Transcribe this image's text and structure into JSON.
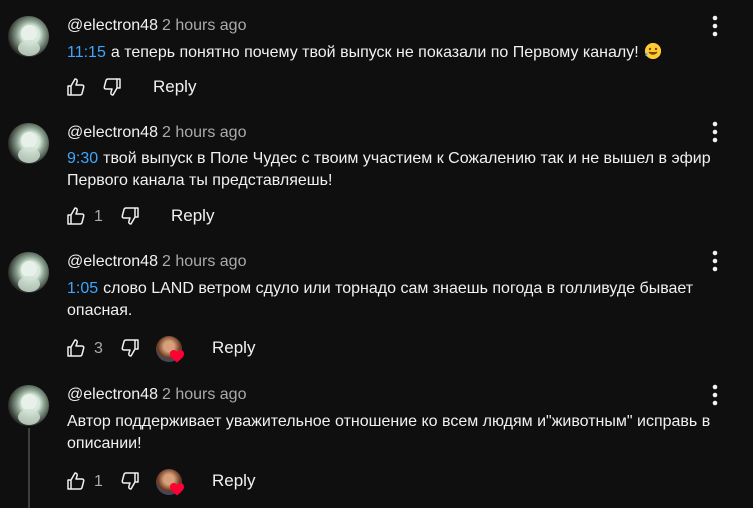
{
  "comments": [
    {
      "author": "@electron48",
      "time": "2 hours ago",
      "timestamp": "11:15",
      "text": "а теперь понятно почему твой выпуск не показали по Первому каналу!",
      "emoji": "rolling-on-floor-laughing",
      "likes": "",
      "reply_label": "Reply",
      "creator_heart": false
    },
    {
      "author": "@electron48",
      "time": "2 hours ago",
      "timestamp": "9:30",
      "text": "твой выпуск в Поле Чудес с твоим участием к Сожалению так и не вышел в эфир Первого канала ты представляешь!",
      "likes": "1",
      "reply_label": "Reply",
      "creator_heart": false
    },
    {
      "author": "@electron48",
      "time": "2 hours ago",
      "timestamp": "1:05",
      "text": "слово LAND ветром сдуло или торнадо сам знаешь погода в голливуде бывает опасная.",
      "likes": "3",
      "reply_label": "Reply",
      "creator_heart": true
    },
    {
      "author": "@electron48",
      "time": "2 hours ago",
      "timestamp": "",
      "text": "Автор поддерживает уважительное отношение ко всем людям и\"животным\" исправь в описании!",
      "likes": "1",
      "reply_label": "Reply",
      "creator_heart": true
    }
  ],
  "colors": {
    "background": "#0f0f0f",
    "text": "#f1f1f1",
    "secondary_text": "#aaaaaa",
    "link": "#3ea6ff",
    "heart": "#ff0033"
  },
  "icons": {
    "menu": "more-vert-icon",
    "like": "thumb-up-icon",
    "dislike": "thumb-down-icon",
    "heart": "heart-icon"
  }
}
